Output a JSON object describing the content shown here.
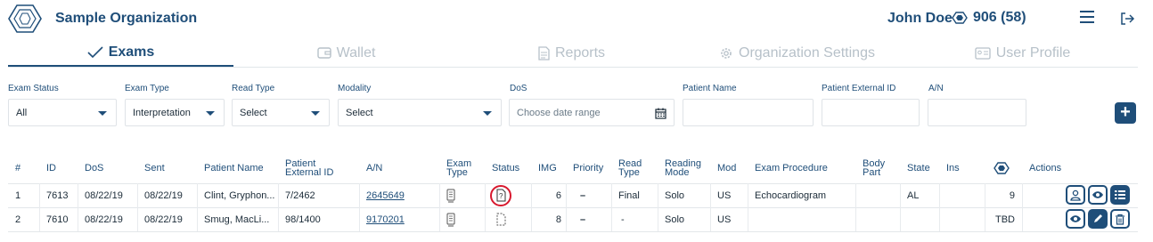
{
  "header": {
    "org_name": "Sample Organization",
    "user_name": "John Doe",
    "credits": "906 (58)"
  },
  "tabs": [
    {
      "label": "Exams",
      "icon": "check-icon",
      "active": true
    },
    {
      "label": "Wallet",
      "icon": "wallet-icon",
      "active": false
    },
    {
      "label": "Reports",
      "icon": "report-icon",
      "active": false
    },
    {
      "label": "Organization Settings",
      "icon": "gear-icon",
      "active": false
    },
    {
      "label": "User Profile",
      "icon": "id-card-icon",
      "active": false
    }
  ],
  "filters": {
    "exam_status": {
      "label": "Exam Status",
      "value": "All"
    },
    "exam_type": {
      "label": "Exam Type",
      "value": "Interpretation"
    },
    "read_type": {
      "label": "Read Type",
      "value": "Select"
    },
    "modality": {
      "label": "Modality",
      "value": "Select"
    },
    "dos": {
      "label": "DoS",
      "placeholder": "Choose date range"
    },
    "patient_name": {
      "label": "Patient Name",
      "value": ""
    },
    "patient_external_id": {
      "label": "Patient External ID",
      "value": ""
    },
    "an": {
      "label": "A/N",
      "value": ""
    },
    "add_label": "+"
  },
  "table": {
    "headers": {
      "num": "#",
      "id": "ID",
      "dos": "DoS",
      "sent": "Sent",
      "patient_name": "Patient Name",
      "patient_ext_line1": "Patient",
      "patient_ext_line2": "External ID",
      "an": "A/N",
      "exam_type_line1": "Exam",
      "exam_type_line2": "Type",
      "status": "Status",
      "img": "IMG",
      "priority": "Priority",
      "read_type_line1": "Read",
      "read_type_line2": "Type",
      "reading_mode_line1": "Reading",
      "reading_mode_line2": "Mode",
      "mod": "Mod",
      "exam_procedure": "Exam Procedure",
      "body_part_line1": "Body",
      "body_part_line2": "Part",
      "state": "State",
      "ins": "Ins",
      "actions": "Actions"
    },
    "rows": [
      {
        "num": "1",
        "id": "7613",
        "dos": "08/22/19",
        "sent": "08/22/19",
        "patient_name": "Clint, Gryphon...",
        "patient_ext_id": "7/2462",
        "an": "2645649",
        "img": "6",
        "priority": "–",
        "read_type": "Final",
        "reading_mode": "Solo",
        "mod": "US",
        "exam_procedure": "Echocardiogram",
        "body_part": "",
        "state": "AL",
        "ins": "",
        "credits": "9",
        "status_icon": "question-document-icon"
      },
      {
        "num": "2",
        "id": "7610",
        "dos": "08/22/19",
        "sent": "08/22/19",
        "patient_name": "Smug, MacLi...",
        "patient_ext_id": "98/1400",
        "an": "9170201",
        "img": "8",
        "priority": "–",
        "read_type": "-",
        "reading_mode": "Solo",
        "mod": "US",
        "exam_procedure": "",
        "body_part": "",
        "state": "",
        "ins": "",
        "credits": "TBD",
        "status_icon": "blank-document-icon"
      }
    ]
  },
  "colors": {
    "primary": "#1f4e79",
    "inactive_tab": "#b7c1c9",
    "status_highlight": "#d8182e"
  }
}
